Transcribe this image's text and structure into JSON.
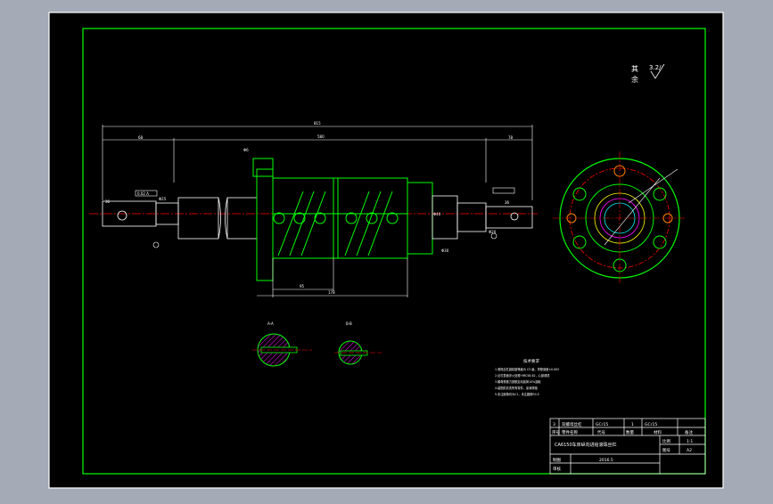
{
  "drawing": {
    "roughness": {
      "line1": "其",
      "line2": "余",
      "symbol": "3.2/"
    },
    "dims": {
      "overall": "815",
      "left_seg": "68",
      "main_span": "580",
      "right_seg": "78",
      "nut_span": "178",
      "nut_sub": "95",
      "center_dia": "Φ40",
      "d1": "Φ25",
      "d2": "Φ30",
      "d3": "Φ20",
      "keyway_left": "36",
      "keyway_right": "36",
      "dia_small": "Φ6",
      "cut_left": "A-A",
      "cut_right": "B-B",
      "tol": "0.02 A"
    },
    "tech_req": {
      "title": "技术要求",
      "items": [
        "1.滚珠丝杠副精度等级为 C5 级，导程误差±0.005",
        "2.丝杠表面淬火处理 HRC58-62，心部调质",
        "3.螺母预紧力按额定动载荷10%选取",
        "4.装配前清洗所有零件，涂润滑脂",
        "5.未注倒角均为C1，未注圆角R0.5"
      ]
    },
    "title_block": {
      "row1": {
        "no": "3",
        "name": "双螺母丝杠",
        "code": "GCr15",
        "qty": "1",
        "material": "GCr15"
      },
      "headers": {
        "no": "序号",
        "name": "零件名称",
        "code": "代号",
        "qty": "数量",
        "material": "材料",
        "remark": "备注"
      },
      "title": "CA6150车床纵向进给滚珠丝杠",
      "scale_label": "比例",
      "scale_value": "1:1",
      "sheet_label": "图号",
      "sheet_value": "A2",
      "drawn_label": "制图",
      "checked_label": "审核",
      "date": "2016.5"
    }
  },
  "colors": {
    "app_bg": "#a4abb7",
    "paper": "#000000",
    "white": "#ffffff",
    "green": "#00ff00",
    "magenta": "#ff00ff",
    "red": "#ff0000",
    "yellow": "#ffff00",
    "cyan": "#00ffff",
    "orange": "#ff8000"
  }
}
